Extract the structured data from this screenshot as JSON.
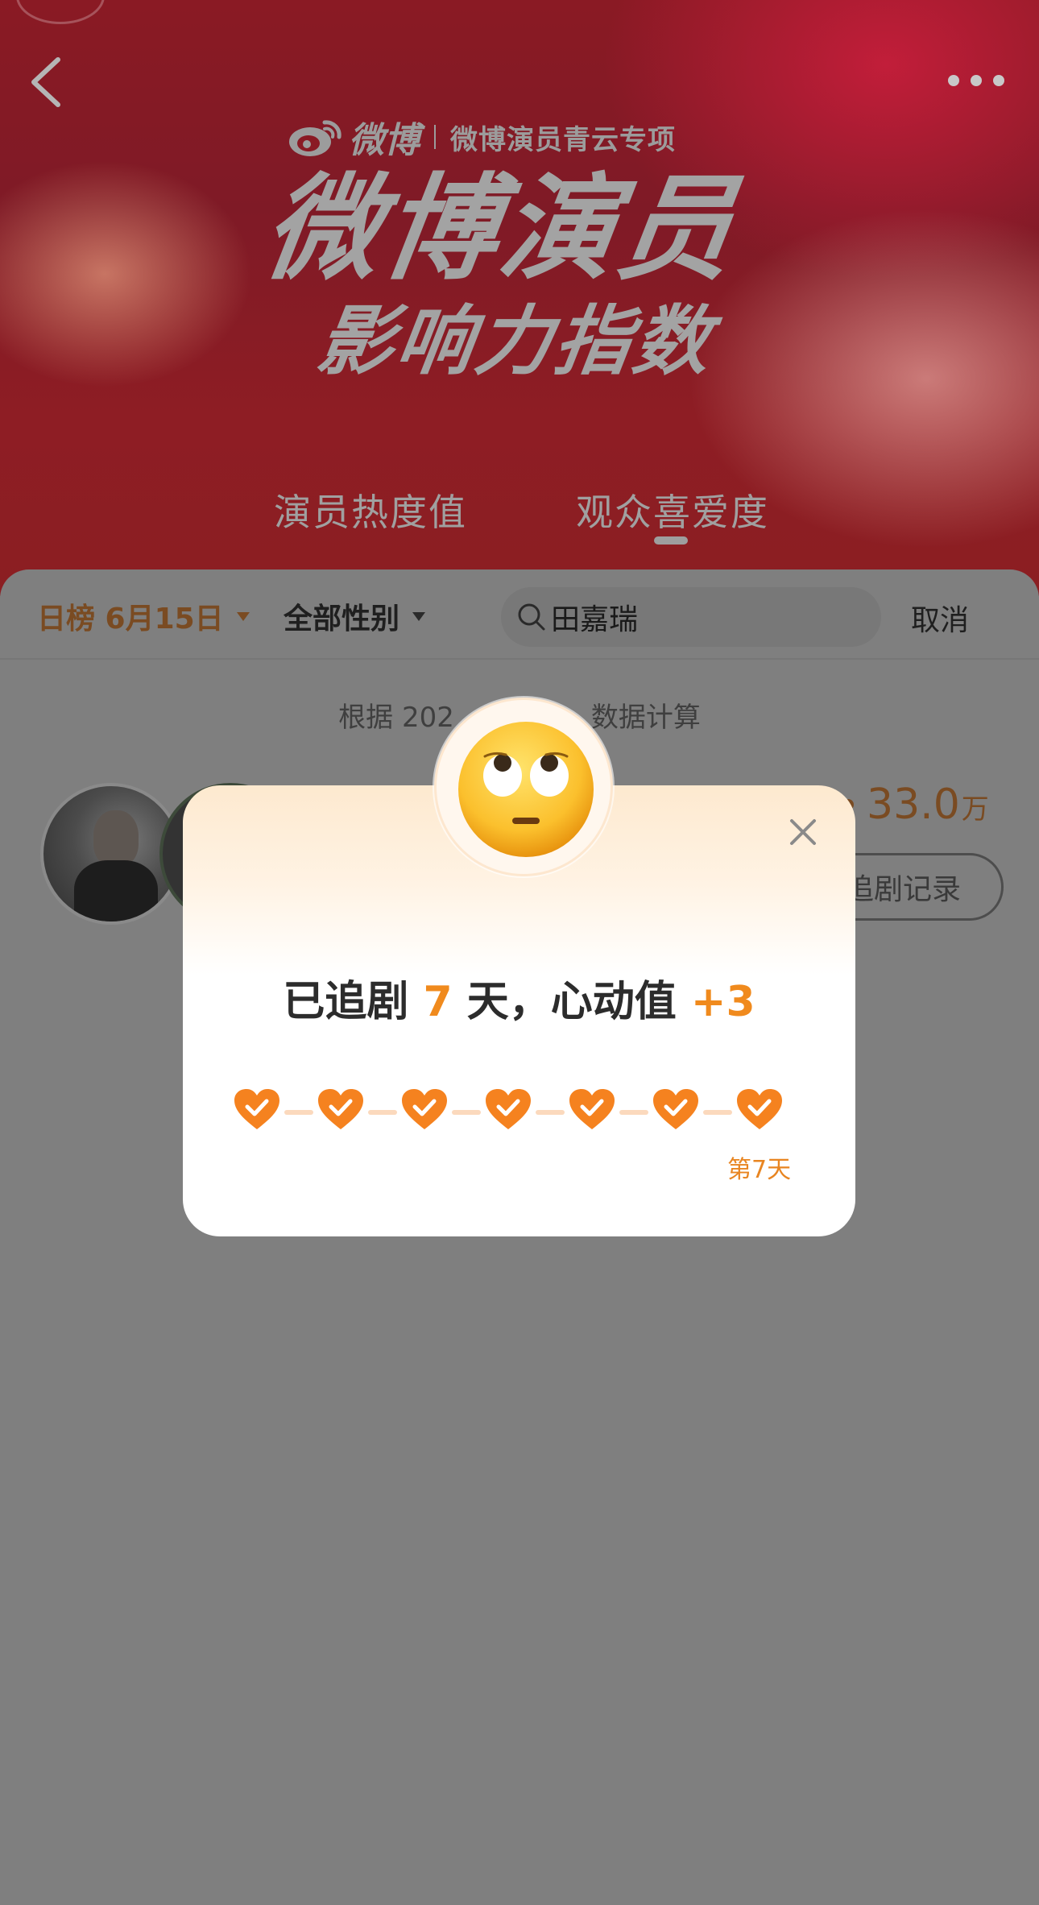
{
  "header": {
    "back_icon": "chevron-left-icon",
    "more_icon": "ellipsis-icon",
    "brand_name": "微博",
    "brand_sub": "微博演员青云专项",
    "title_main": "微博演员",
    "title_sub": "影响力指数"
  },
  "tabs": [
    {
      "label": "演员热度值"
    },
    {
      "label": "观众喜爱度",
      "active": true
    }
  ],
  "filters": {
    "date_label": "日榜 6月15日",
    "gender_label": "全部性别",
    "search_icon": "search-icon",
    "search_value": "田嘉瑞",
    "cancel_label": "取消"
  },
  "content": {
    "note_left": "根据 202",
    "note_right": "数据计算",
    "score_value": "33.0",
    "score_unit": "万",
    "record_label": "追剧记录"
  },
  "modal": {
    "emoji_icon": "eye-roll-emoji-icon",
    "msg_prefix": "已追剧 ",
    "msg_days": "7",
    "msg_middle": " 天，心动值 ",
    "msg_points": "+3",
    "heart_count": 7,
    "day_label": "第7天",
    "close_icon": "close-icon"
  },
  "colors": {
    "accent_orange": "#f08a1d",
    "banner_red": "#8a1a24",
    "overlay_gray": "#7f7f7f"
  }
}
